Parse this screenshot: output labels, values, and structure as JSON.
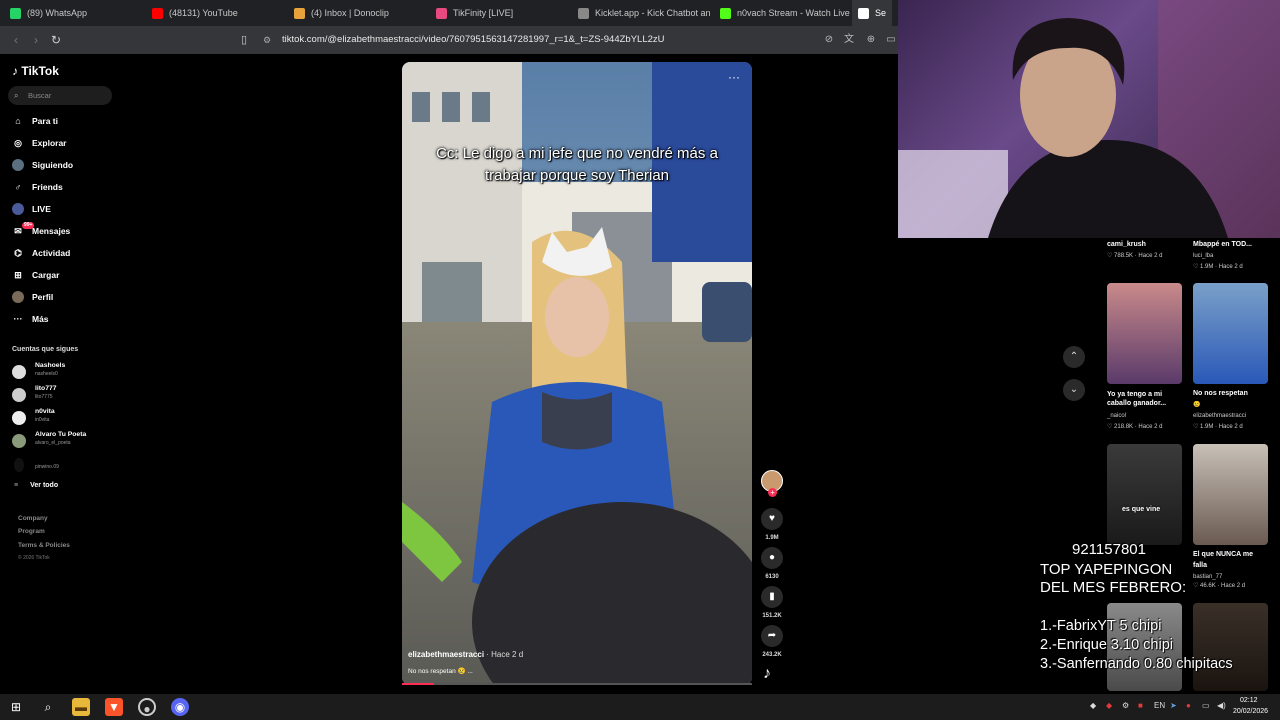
{
  "browser": {
    "tabs": [
      {
        "label": "(89) WhatsApp",
        "color": "#25d366"
      },
      {
        "label": "(48131) YouTube",
        "color": "#ff0000"
      },
      {
        "label": "(4) Inbox | Donoclip",
        "color": "#e8a33d"
      },
      {
        "label": "TikFinity [LIVE]",
        "color": "#e84a7f"
      },
      {
        "label": "Kicklet.app - Kick Chatbot and",
        "color": "#888888"
      },
      {
        "label": "n0vach Stream - Watch Live on",
        "color": "#53fc18"
      },
      {
        "label": "Se",
        "color": "#ffffff"
      }
    ],
    "url": "tiktok.com/@elizabethmaestracci/video/7607951563147281997_r=1&_t=ZS-944ZbYLL2zU"
  },
  "sidebar": {
    "logo": "TikTok",
    "search_placeholder": "Buscar",
    "nav": [
      {
        "label": "Para ti",
        "icon": "home-icon"
      },
      {
        "label": "Explorar",
        "icon": "compass-icon"
      },
      {
        "label": "Siguiendo",
        "icon": "following-icon"
      },
      {
        "label": "Friends",
        "icon": "friends-icon"
      },
      {
        "label": "LIVE",
        "icon": "live-icon"
      },
      {
        "label": "Mensajes",
        "icon": "messages-icon",
        "badge": "99+"
      },
      {
        "label": "Actividad",
        "icon": "activity-icon"
      },
      {
        "label": "Cargar",
        "icon": "upload-icon"
      },
      {
        "label": "Perfil",
        "icon": "profile-icon"
      },
      {
        "label": "Más",
        "icon": "more-icon"
      }
    ],
    "following_title": "Cuentas que sigues",
    "accounts": [
      {
        "name": "Nashoels",
        "handle": "nasheels0"
      },
      {
        "name": "lito777",
        "handle": "lito7775"
      },
      {
        "name": "n0vita",
        "handle": "in0vita"
      },
      {
        "name": "Alvaro Tu Poeta",
        "handle": "alvaro_el_poeta"
      },
      {
        "name": "",
        "handle": "pinwino.09"
      }
    ],
    "see_all": "Ver todo",
    "footer": [
      "Company",
      "Program",
      "Terms & Policies"
    ],
    "copyright": "© 2026 TikTok"
  },
  "video": {
    "caption": "Cc: Le digo a mi jefe que no vendré más a trabajar porque soy Therian",
    "author": "elizabethmaestracci",
    "time": " · Hace 2 d",
    "description": "No nos respetan 😢 ...",
    "likes": "1.9M",
    "comments": "6130",
    "saves": "151.2K",
    "shares": "243.2K",
    "progress": 0.09
  },
  "recommended": [
    {
      "title": "",
      "user": "cami_krush",
      "stats": "♡ 788.5K · Hace 2 d"
    },
    {
      "title": "Mbappé en TOD...",
      "user": "luci_lba",
      "stats": "♡ 1.9M · Hace 2 d"
    },
    {
      "title": "Yo ya tengo a mi caballo ganador...",
      "user": "_naicol",
      "stats": "♡ 218.8K · Hace 2 d"
    },
    {
      "title": "No nos respetan",
      "user": "elizabethmaestracci",
      "stats": "♡ 1.9M · Hace 2 d",
      "emoji": "😢"
    },
    {
      "title": "",
      "user": "",
      "stats": "",
      "overlay": "es que vine"
    },
    {
      "title": "El que NUNCA me falla",
      "user": "bastian_77",
      "stats": "♡ 46.6K · Hace 2 d"
    }
  ],
  "stream_overlay": {
    "code": "921157801",
    "title_line1": "TOP YAPEPINGON",
    "title_line2": "DEL MES FEBRERO:",
    "ranks": [
      "1.-FabrixYT 5 chipi",
      "2.-Enrique 3.10 chipi",
      "3.-Sanfernando 0.80 chipitacs"
    ]
  },
  "taskbar": {
    "time": "02:12",
    "date": "20/02/2026"
  }
}
